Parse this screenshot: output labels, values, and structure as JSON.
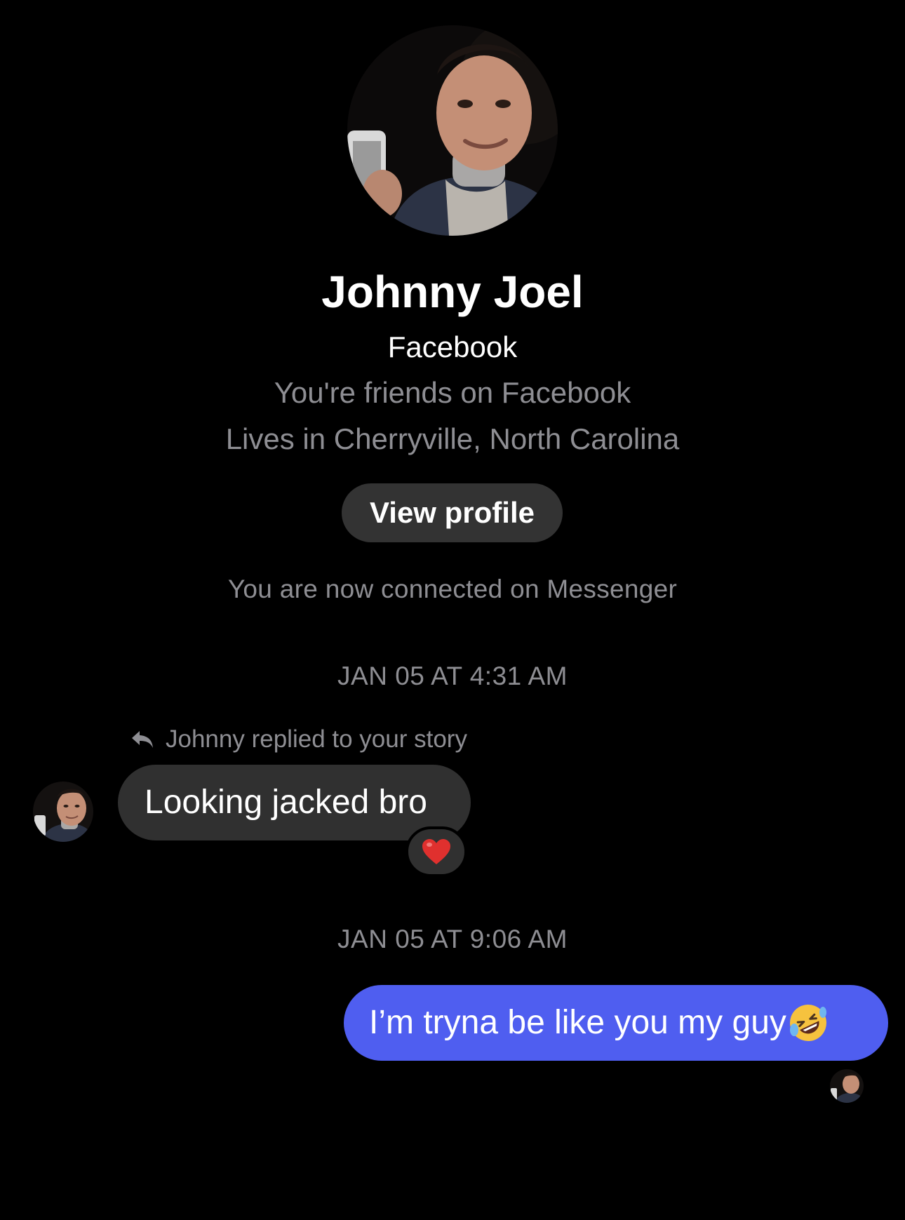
{
  "profile": {
    "name": "Johnny Joel",
    "source": "Facebook",
    "friends_line": "You're friends on Facebook",
    "location_line": "Lives in Cherryville, North Carolina",
    "view_profile_label": "View profile"
  },
  "thread": {
    "connected_note": "You are now connected on Messenger",
    "timestamps": [
      "JAN 05 AT 4:31 AM",
      "JAN 05 AT 9:06 AM"
    ],
    "incoming": {
      "context": "Johnny replied to your story",
      "text": "Looking jacked bro",
      "reaction": "heart"
    },
    "outgoing": {
      "text": "I’m tryna be like you my guy",
      "emoji": "rolling-on-floor-laughing"
    }
  },
  "colors": {
    "background": "#000000",
    "incoming_bubble": "#303030",
    "outgoing_bubble": "#4f5ef0",
    "secondary_text": "#8e8e93"
  }
}
